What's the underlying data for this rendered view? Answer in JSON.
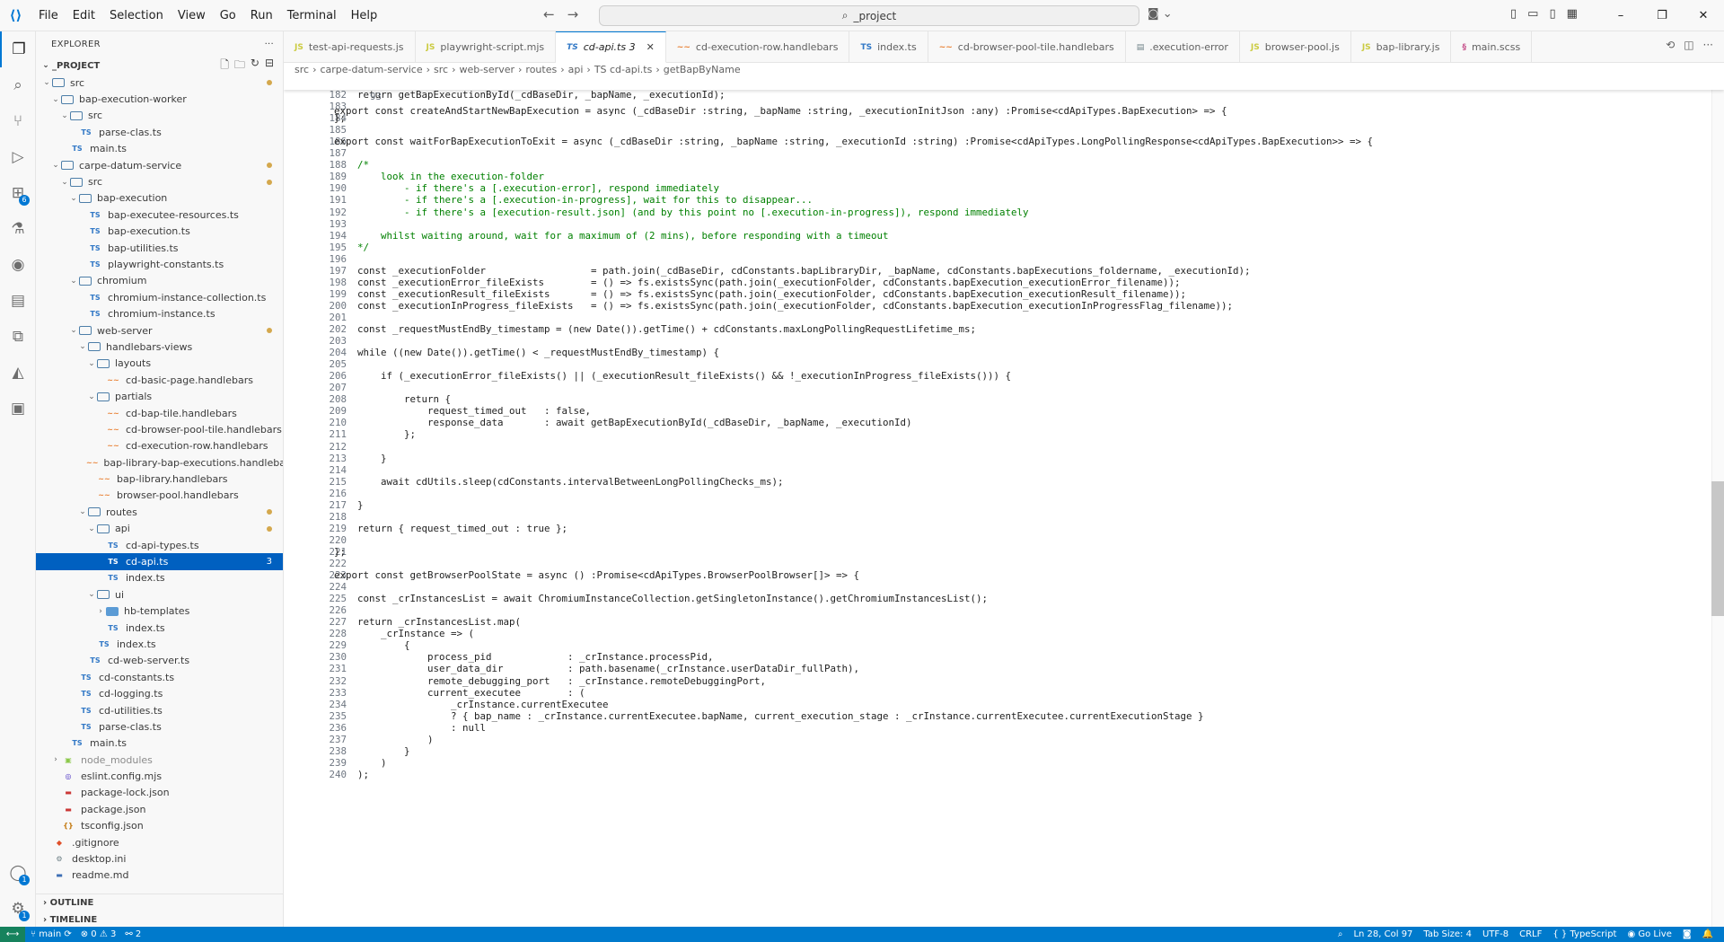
{
  "titlebar": {
    "menu": [
      "File",
      "Edit",
      "Selection",
      "View",
      "Go",
      "Run",
      "Terminal",
      "Help"
    ],
    "search_text": "_project",
    "window_controls": [
      "–",
      "❐",
      "✕"
    ]
  },
  "activitybar": {
    "extensions_badge": "6",
    "accounts_badge": "1",
    "settings_badge": "1"
  },
  "sidebar": {
    "title": "EXPLORER",
    "project": "_PROJECT",
    "tree": [
      {
        "label": "src",
        "depth": 0,
        "type": "folder-src",
        "open": true,
        "dot": true
      },
      {
        "label": "bap-execution-worker",
        "depth": 1,
        "type": "folder",
        "open": true
      },
      {
        "label": "src",
        "depth": 2,
        "type": "folder-src",
        "open": true
      },
      {
        "label": "parse-clas.ts",
        "depth": 3,
        "type": "ts"
      },
      {
        "label": "main.ts",
        "depth": 2,
        "type": "ts"
      },
      {
        "label": "carpe-datum-service",
        "depth": 1,
        "type": "folder",
        "open": true,
        "dot": true
      },
      {
        "label": "src",
        "depth": 2,
        "type": "folder-src",
        "open": true,
        "dot": true
      },
      {
        "label": "bap-execution",
        "depth": 3,
        "type": "folder",
        "open": true
      },
      {
        "label": "bap-executee-resources.ts",
        "depth": 4,
        "type": "ts"
      },
      {
        "label": "bap-execution.ts",
        "depth": 4,
        "type": "ts"
      },
      {
        "label": "bap-utilities.ts",
        "depth": 4,
        "type": "ts"
      },
      {
        "label": "playwright-constants.ts",
        "depth": 4,
        "type": "ts"
      },
      {
        "label": "chromium",
        "depth": 3,
        "type": "folder",
        "open": true
      },
      {
        "label": "chromium-instance-collection.ts",
        "depth": 4,
        "type": "ts"
      },
      {
        "label": "chromium-instance.ts",
        "depth": 4,
        "type": "ts"
      },
      {
        "label": "web-server",
        "depth": 3,
        "type": "folder",
        "open": true,
        "dot": true
      },
      {
        "label": "handlebars-views",
        "depth": 4,
        "type": "folder",
        "open": true
      },
      {
        "label": "layouts",
        "depth": 5,
        "type": "folder-src",
        "open": true
      },
      {
        "label": "cd-basic-page.handlebars",
        "depth": 6,
        "type": "hbs"
      },
      {
        "label": "partials",
        "depth": 5,
        "type": "folder",
        "open": true
      },
      {
        "label": "cd-bap-tile.handlebars",
        "depth": 6,
        "type": "hbs"
      },
      {
        "label": "cd-browser-pool-tile.handlebars",
        "depth": 6,
        "type": "hbs"
      },
      {
        "label": "cd-execution-row.handlebars",
        "depth": 6,
        "type": "hbs"
      },
      {
        "label": "bap-library-bap-executions.handlebars",
        "depth": 5,
        "type": "hbs"
      },
      {
        "label": "bap-library.handlebars",
        "depth": 5,
        "type": "hbs"
      },
      {
        "label": "browser-pool.handlebars",
        "depth": 5,
        "type": "hbs"
      },
      {
        "label": "routes",
        "depth": 4,
        "type": "folder",
        "open": true,
        "dot": true
      },
      {
        "label": "api",
        "depth": 5,
        "type": "folder",
        "open": true,
        "dot": true
      },
      {
        "label": "cd-api-types.ts",
        "depth": 6,
        "type": "ts"
      },
      {
        "label": "cd-api.ts",
        "depth": 6,
        "type": "ts",
        "selected": true,
        "count": "3"
      },
      {
        "label": "index.ts",
        "depth": 6,
        "type": "ts"
      },
      {
        "label": "ui",
        "depth": 5,
        "type": "folder",
        "open": true
      },
      {
        "label": "hb-templates",
        "depth": 6,
        "type": "folder-blue",
        "open": false
      },
      {
        "label": "index.ts",
        "depth": 6,
        "type": "ts"
      },
      {
        "label": "index.ts",
        "depth": 5,
        "type": "ts"
      },
      {
        "label": "cd-web-server.ts",
        "depth": 4,
        "type": "ts"
      },
      {
        "label": "cd-constants.ts",
        "depth": 3,
        "type": "ts"
      },
      {
        "label": "cd-logging.ts",
        "depth": 3,
        "type": "ts"
      },
      {
        "label": "cd-utilities.ts",
        "depth": 3,
        "type": "ts"
      },
      {
        "label": "parse-clas.ts",
        "depth": 3,
        "type": "ts"
      },
      {
        "label": "main.ts",
        "depth": 2,
        "type": "ts"
      },
      {
        "label": "node_modules",
        "depth": 1,
        "type": "node",
        "open": false,
        "dim": true
      },
      {
        "label": "eslint.config.mjs",
        "depth": 1,
        "type": "eslint"
      },
      {
        "label": "package-lock.json",
        "depth": 1,
        "type": "npm"
      },
      {
        "label": "package.json",
        "depth": 1,
        "type": "npm"
      },
      {
        "label": "tsconfig.json",
        "depth": 1,
        "type": "json"
      },
      {
        "label": ".gitignore",
        "depth": 0,
        "type": "git"
      },
      {
        "label": "desktop.ini",
        "depth": 0,
        "type": "gear"
      },
      {
        "label": "readme.md",
        "depth": 0,
        "type": "md"
      }
    ],
    "outline": "OUTLINE",
    "timeline": "TIMELINE"
  },
  "tabs": [
    {
      "label": "test-api-requests.js",
      "icon": "JS",
      "kind": "js"
    },
    {
      "label": "playwright-script.mjs",
      "icon": "JS",
      "kind": "js"
    },
    {
      "label": "cd-api.ts 3",
      "icon": "TS",
      "kind": "ts",
      "active": true
    },
    {
      "label": "cd-execution-row.handlebars",
      "icon": "~~",
      "kind": "hbs"
    },
    {
      "label": "index.ts",
      "icon": "TS",
      "kind": "ts"
    },
    {
      "label": "cd-browser-pool-tile.handlebars",
      "icon": "~~",
      "kind": "hbs"
    },
    {
      "label": ".execution-error",
      "icon": "▤",
      "kind": "err"
    },
    {
      "label": "browser-pool.js",
      "icon": "JS",
      "kind": "js"
    },
    {
      "label": "bap-library.js",
      "icon": "JS",
      "kind": "js"
    },
    {
      "label": "main.scss",
      "icon": "§",
      "kind": "scss"
    }
  ],
  "breadcrumb": [
    "src",
    "carpe-datum-service",
    "src",
    "web-server",
    "routes",
    "api",
    "TS cd-api.ts",
    "getBapByName"
  ],
  "editor": {
    "sticky": {
      "n": "93",
      "t": "export const createAndStartNewBapExecution = async (_cdBaseDir :string, _bapName :string, _executionInitJson :any) :Promise<cdApiTypes.BapExecution> => {"
    },
    "lines": [
      {
        "n": "182",
        "t": "    return getBapExecutionById(_cdBaseDir, _bapName, _executionId);"
      },
      {
        "n": "183",
        "t": ""
      },
      {
        "n": "184",
        "t": "};"
      },
      {
        "n": "185",
        "t": ""
      },
      {
        "n": "186",
        "t": "export const waitForBapExecutionToExit = async (_cdBaseDir :string, _bapName :string, _executionId :string) :Promise<cdApiTypes.LongPollingResponse<cdApiTypes.BapExecution>> => {"
      },
      {
        "n": "187",
        "t": ""
      },
      {
        "n": "188",
        "t": "    /*",
        "c": true
      },
      {
        "n": "189",
        "t": "        look in the execution-folder",
        "c": true
      },
      {
        "n": "190",
        "t": "            - if there's a [.execution-error], respond immediately",
        "c": true
      },
      {
        "n": "191",
        "t": "            - if there's a [.execution-in-progress], wait for this to disappear...",
        "c": true
      },
      {
        "n": "192",
        "t": "            - if there's a [execution-result.json] (and by this point no [.execution-in-progress]), respond immediately",
        "c": true
      },
      {
        "n": "193",
        "t": "",
        "c": true
      },
      {
        "n": "194",
        "t": "        whilst waiting around, wait for a maximum of (2 mins), before responding with a timeout",
        "c": true
      },
      {
        "n": "195",
        "t": "    */",
        "c": true
      },
      {
        "n": "196",
        "t": ""
      },
      {
        "n": "197",
        "t": "    const _executionFolder                  = path.join(_cdBaseDir, cdConstants.bapLibraryDir, _bapName, cdConstants.bapExecutions_foldername, _executionId);"
      },
      {
        "n": "198",
        "t": "    const _executionError_fileExists        = () => fs.existsSync(path.join(_executionFolder, cdConstants.bapExecution_executionError_filename));"
      },
      {
        "n": "199",
        "t": "    const _executionResult_fileExists       = () => fs.existsSync(path.join(_executionFolder, cdConstants.bapExecution_executionResult_filename));"
      },
      {
        "n": "200",
        "t": "    const _executionInProgress_fileExists   = () => fs.existsSync(path.join(_executionFolder, cdConstants.bapExecution_executionInProgressFlag_filename));"
      },
      {
        "n": "201",
        "t": ""
      },
      {
        "n": "202",
        "t": "    const _requestMustEndBy_timestamp = (new Date()).getTime() + cdConstants.maxLongPollingRequestLifetime_ms;"
      },
      {
        "n": "203",
        "t": ""
      },
      {
        "n": "204",
        "t": "    while ((new Date()).getTime() < _requestMustEndBy_timestamp) {"
      },
      {
        "n": "205",
        "t": ""
      },
      {
        "n": "206",
        "t": "        if (_executionError_fileExists() || (_executionResult_fileExists() && !_executionInProgress_fileExists())) {"
      },
      {
        "n": "207",
        "t": ""
      },
      {
        "n": "208",
        "t": "            return {"
      },
      {
        "n": "209",
        "t": "                request_timed_out   : false,"
      },
      {
        "n": "210",
        "t": "                response_data       : await getBapExecutionById(_cdBaseDir, _bapName, _executionId)"
      },
      {
        "n": "211",
        "t": "            };"
      },
      {
        "n": "212",
        "t": ""
      },
      {
        "n": "213",
        "t": "        }"
      },
      {
        "n": "214",
        "t": ""
      },
      {
        "n": "215",
        "t": "        await cdUtils.sleep(cdConstants.intervalBetweenLongPollingChecks_ms);"
      },
      {
        "n": "216",
        "t": ""
      },
      {
        "n": "217",
        "t": "    }"
      },
      {
        "n": "218",
        "t": ""
      },
      {
        "n": "219",
        "t": "    return { request_timed_out : true };"
      },
      {
        "n": "220",
        "t": ""
      },
      {
        "n": "221",
        "t": "};"
      },
      {
        "n": "222",
        "t": ""
      },
      {
        "n": "223",
        "t": "export const getBrowserPoolState = async () :Promise<cdApiTypes.BrowserPoolBrowser[]> => {"
      },
      {
        "n": "224",
        "t": ""
      },
      {
        "n": "225",
        "t": "    const _crInstancesList = await ChromiumInstanceCollection.getSingletonInstance().getChromiumInstancesList();"
      },
      {
        "n": "226",
        "t": ""
      },
      {
        "n": "227",
        "t": "    return _crInstancesList.map("
      },
      {
        "n": "228",
        "t": "        _crInstance => ("
      },
      {
        "n": "229",
        "t": "            {"
      },
      {
        "n": "230",
        "t": "                process_pid             : _crInstance.processPid,"
      },
      {
        "n": "231",
        "t": "                user_data_dir           : path.basename(_crInstance.userDataDir_fullPath),"
      },
      {
        "n": "232",
        "t": "                remote_debugging_port   : _crInstance.remoteDebuggingPort,"
      },
      {
        "n": "233",
        "t": "                current_executee        : ("
      },
      {
        "n": "234",
        "t": "                    _crInstance.currentExecutee"
      },
      {
        "n": "235",
        "t": "                    ? { bap_name : _crInstance.currentExecutee.bapName, current_execution_stage : _crInstance.currentExecutee.currentExecutionStage }"
      },
      {
        "n": "236",
        "t": "                    : null"
      },
      {
        "n": "237",
        "t": "                )"
      },
      {
        "n": "238",
        "t": "            }"
      },
      {
        "n": "239",
        "t": "        )"
      },
      {
        "n": "240",
        "t": "    );"
      }
    ]
  },
  "statusbar": {
    "branch": "main",
    "problems": "⊗ 0 ⚠ 3",
    "ports": "2",
    "position": "Ln 28, Col 97",
    "tabsize": "Tab Size: 4",
    "encoding": "UTF-8",
    "eol": "CRLF",
    "language": "TypeScript",
    "golive": "Go Live"
  }
}
